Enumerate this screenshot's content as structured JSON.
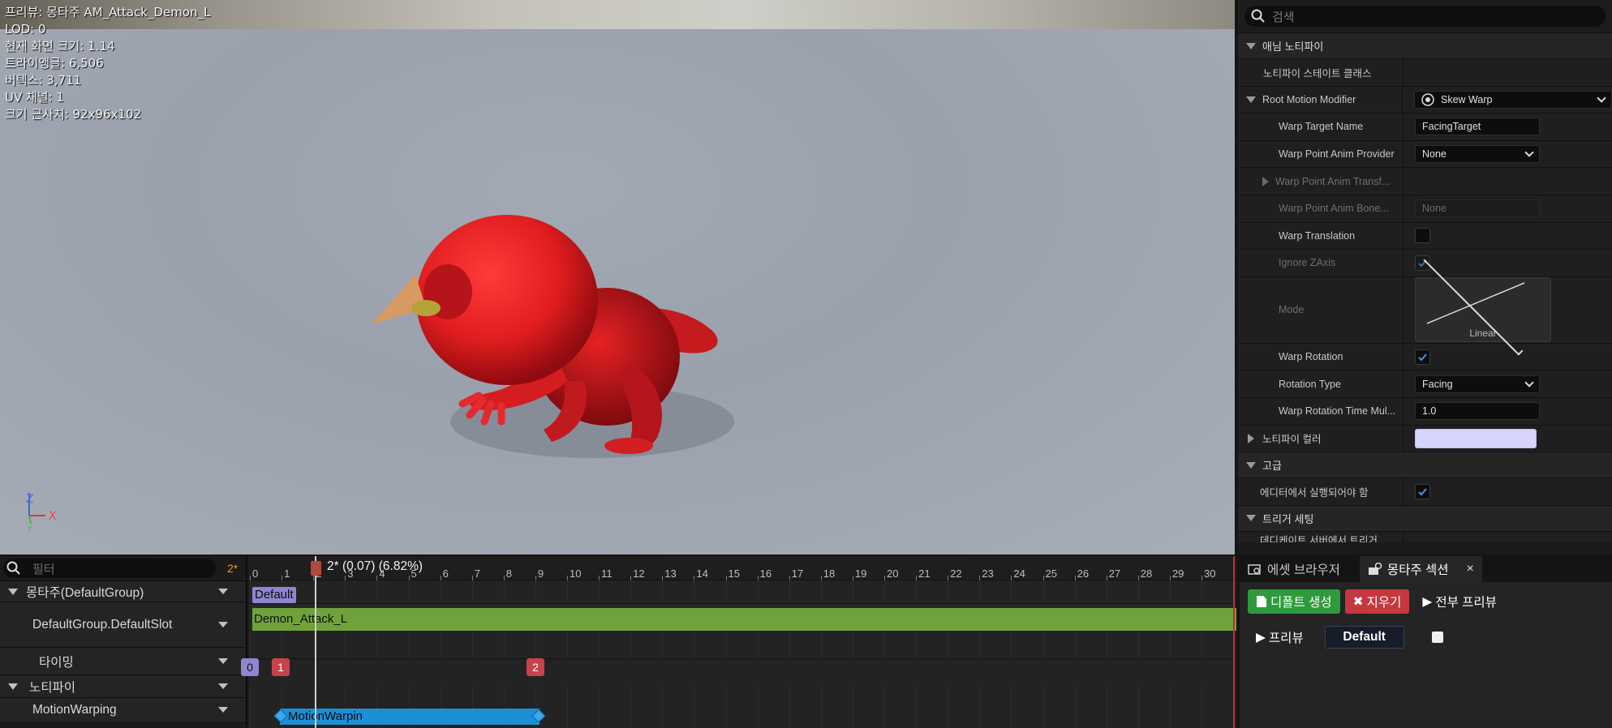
{
  "viewport": {
    "info_lines": [
      "프리뷰: 몽타주 AM_Attack_Demon_L",
      "LOD: 0",
      "현재 화면 크기: 1.14",
      "트라이앵글: 6,506",
      "버텍스: 3,711",
      "UV 채널: 1",
      "크기 근사치: 92x96x102"
    ],
    "axis": {
      "z": "Z",
      "x": "X",
      "y": "Y"
    }
  },
  "details": {
    "search_placeholder": "검색",
    "sections": {
      "anim_notify": "애님 노티파이",
      "advanced": "고급",
      "trigger": "트리거 세팅"
    },
    "props": {
      "notify_state_class": "노티파이 스테이트 클래스",
      "root_motion_modifier": "Root Motion Modifier",
      "root_motion_value": "Skew Warp",
      "warp_target_name": "Warp Target Name",
      "warp_target_value": "FacingTarget",
      "warp_point_anim_provider": "Warp Point Anim Provider",
      "warp_point_anim_provider_value": "None",
      "warp_point_anim_transform": "Warp Point Anim Transf...",
      "warp_point_anim_bone": "Warp Point Anim Bone...",
      "warp_point_anim_bone_value": "None",
      "warp_translation": "Warp Translation",
      "ignore_zaxis": "Ignore ZAxis",
      "mode": "Mode",
      "mode_value": "Linear",
      "warp_rotation": "Warp Rotation",
      "rotation_type": "Rotation Type",
      "rotation_type_value": "Facing",
      "warp_rotation_time_mul": "Warp Rotation Time Mul...",
      "warp_rotation_time_mul_value": "1.0",
      "notify_color": "노티파이 컬러",
      "should_fire_in_editor": "에디터에서 실행되어야 함",
      "trigger_cut": "데디케이트 서버에서 트리거"
    },
    "notify_color_hex": "#d4d4fc"
  },
  "timeline": {
    "filter_placeholder": "필터",
    "count": "2*",
    "tracks": {
      "montage_group": "몽타주(DefaultGroup)",
      "slot": "DefaultGroup.DefaultSlot",
      "timing": "타이밍",
      "notifies": "노티파이",
      "motion_warping": "MotionWarping"
    },
    "scrubber_label": "2* (0.07) (6.82%)",
    "ruler_ticks": [
      "0",
      "1",
      "2",
      "3",
      "4",
      "5",
      "6",
      "7",
      "8",
      "9",
      "10",
      "11",
      "12",
      "13",
      "14",
      "15",
      "16",
      "17",
      "18",
      "19",
      "20",
      "21",
      "22",
      "23",
      "24",
      "25",
      "26",
      "27",
      "28",
      "29",
      "30"
    ],
    "section_label": "Default",
    "segment_label": "Demon_Attack_L",
    "timing_markers": [
      "0",
      "1",
      "2"
    ],
    "notify_label": "MotionWarpin"
  },
  "montage_panel": {
    "tab_asset_browser": "에셋 브라우저",
    "tab_montage_sections": "몽타주 섹션",
    "close": "×",
    "btn_create_default": "디폴트 생성",
    "btn_clear": "지우기",
    "btn_preview_all": "전부 프리뷰",
    "btn_preview": "프리뷰",
    "btn_default": "Default"
  }
}
